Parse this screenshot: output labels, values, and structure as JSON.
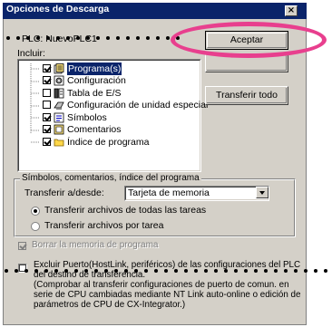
{
  "dialog": {
    "title": "Opciones de Descarga",
    "close_glyph": "×"
  },
  "plc": {
    "label": "PLC: NuevoPLC1"
  },
  "buttons": {
    "accept": "Aceptar",
    "transfer_all": "Transferir todo"
  },
  "include": {
    "label": "Incluir:",
    "items": [
      {
        "label": "Programa(s)",
        "checked": true,
        "icon": "programs-icon",
        "selected": true
      },
      {
        "label": "Configuración",
        "checked": true,
        "icon": "settings-icon"
      },
      {
        "label": "Tabla de E/S",
        "checked": false,
        "icon": "io-table-icon"
      },
      {
        "label": "Configuración de unidad especial",
        "checked": false,
        "icon": "special-unit-icon"
      },
      {
        "label": "Símbolos",
        "checked": true,
        "icon": "symbols-icon"
      },
      {
        "label": "Comentarios",
        "checked": true,
        "icon": "comments-icon"
      },
      {
        "label": "Índice de programa",
        "checked": true,
        "icon": "folder-icon"
      }
    ]
  },
  "group": {
    "label": "Símbolos, comentarios, índice del programa",
    "transfer_label": "Transferir a/desde:",
    "transfer_value": "Tarjeta de memoria",
    "radio_all": "Transferir archivos de todas las tareas",
    "radio_task": "Transferir archivos por tarea"
  },
  "options": {
    "clear_memory": "Borrar la memoria de programa",
    "exclude_ports": "Excluir Puerto(HostLink, periféricos) de las configuraciones del PLC del destino de transferencia.",
    "exclude_note": "(Comprobar al transferir configuraciones de puerto de comun. en serie de CPU cambiadas mediante NT Link auto-online o edición de parámetros de CPU de CX-Integrator.)"
  },
  "colors": {
    "highlight": "#e83f8e",
    "titlebar": "#0a246a",
    "dialog_bg": "#d4d0c8"
  }
}
